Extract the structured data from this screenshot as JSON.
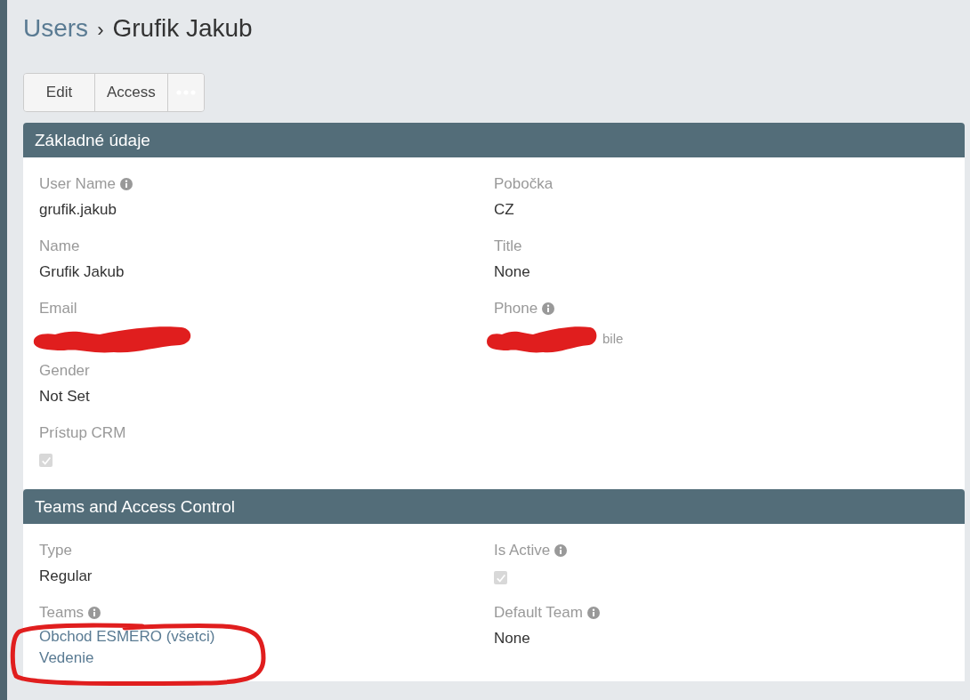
{
  "breadcrumb": {
    "parent": "Users",
    "separator": "›",
    "current": "Grufik Jakub"
  },
  "actions": [
    {
      "label": "Edit"
    },
    {
      "label": "Access"
    }
  ],
  "panels": [
    {
      "title": "Základné údaje",
      "columns": [
        [
          {
            "label": "User Name",
            "info": true,
            "kind": "text",
            "value": "grufik.jakub"
          },
          {
            "label": "Name",
            "info": false,
            "kind": "text",
            "value": "Grufik Jakub"
          },
          {
            "label": "Email",
            "info": false,
            "kind": "redacted"
          },
          {
            "label": "Gender",
            "info": false,
            "kind": "text",
            "value": "Not Set"
          },
          {
            "label": "Prístup CRM",
            "info": false,
            "kind": "checkbox",
            "checked": true,
            "disabled": true
          }
        ],
        [
          {
            "label": "Pobočka",
            "info": false,
            "kind": "text",
            "value": "CZ"
          },
          {
            "label": "Title",
            "info": false,
            "kind": "text",
            "value": "None"
          },
          {
            "label": "Phone",
            "info": true,
            "kind": "redacted",
            "tail": "bile"
          }
        ]
      ]
    },
    {
      "title": "Teams and Access Control",
      "columns": [
        [
          {
            "label": "Type",
            "info": false,
            "kind": "text",
            "value": "Regular"
          },
          {
            "label": "Teams",
            "info": true,
            "kind": "links",
            "values": [
              "Obchod ESMERO (všetci)",
              "Vedenie"
            ],
            "circled": true
          }
        ],
        [
          {
            "label": "Is Active",
            "info": true,
            "kind": "checkbox",
            "checked": true,
            "disabled": true
          },
          {
            "label": "Default Team",
            "info": true,
            "kind": "text",
            "value": "None"
          }
        ]
      ]
    }
  ]
}
